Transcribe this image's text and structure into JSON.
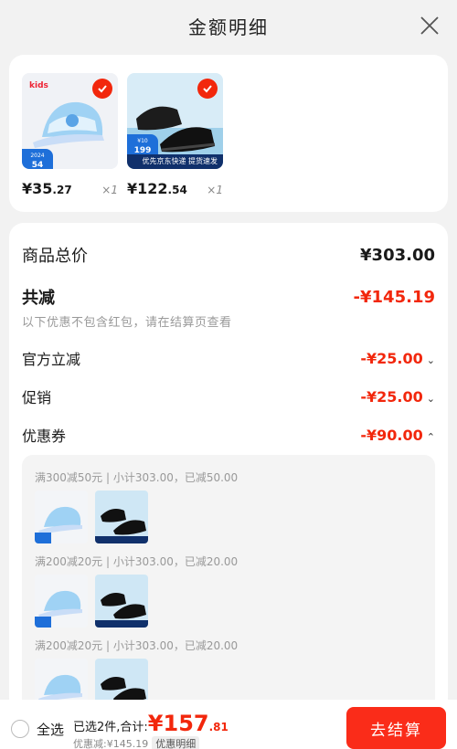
{
  "header": {
    "title": "金额明细"
  },
  "products": [
    {
      "price_int": "¥35",
      "price_dec": ".27",
      "qty": "×1",
      "badge": "54",
      "brand": "kids"
    },
    {
      "price_int": "¥122",
      "price_dec": ".54",
      "qty": "×1",
      "badge": "199",
      "promo": "优先京东快递 提货速发"
    }
  ],
  "totals": {
    "product_total_label": "商品总价",
    "product_total_value": "¥303.00",
    "discount_label": "共减",
    "discount_value": "-¥145.19",
    "note": "以下优惠不包含红包，请在结算页查看",
    "official_label": "官方立减",
    "official_value": "-¥25.00",
    "promo_label": "促销",
    "promo_value": "-¥25.00",
    "coupon_label": "优惠券",
    "coupon_value": "-¥90.00"
  },
  "coupons": [
    {
      "title": "满300减50元 | 小计303.00，已减50.00"
    },
    {
      "title": "满200减20元 | 小计303.00，已减20.00"
    },
    {
      "title": "满200减20元 | 小计303.00，已减20.00"
    }
  ],
  "bottom": {
    "select_all": "全选",
    "selected_text": "已选2件,合计:",
    "total_int": "¥157",
    "total_dec": ".81",
    "discount_text": "优惠减:¥145.19",
    "detail_label": "优惠明细",
    "checkout_label": "去结算"
  },
  "colors": {
    "accent": "#f2270c",
    "checkout": "#fa2c19"
  }
}
